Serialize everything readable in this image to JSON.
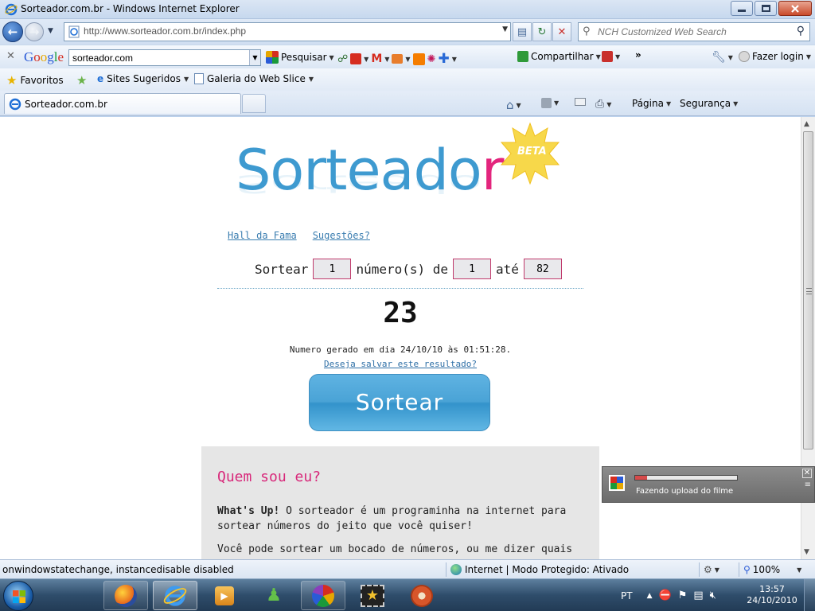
{
  "window": {
    "title": "Sorteador.com.br - Windows Internet Explorer"
  },
  "address": {
    "url": "http://www.sorteador.com.br/index.php"
  },
  "search": {
    "placeholder": "NCH Customized Web Search"
  },
  "google_toolbar": {
    "logo": "Google",
    "query": "sorteador.com",
    "search_label": "Pesquisar",
    "share_label": "Compartilhar",
    "login_label": "Fazer login"
  },
  "favorites": {
    "favorites_label": "Favoritos",
    "suggested_label": "Sites Sugeridos",
    "gallery_label": "Galeria do Web Slice"
  },
  "tabs": {
    "active_title": "Sorteador.com.br"
  },
  "commandbar": {
    "page_label": "Página",
    "security_label": "Segurança"
  },
  "page": {
    "logo_main": "Sorteado",
    "logo_last": "r",
    "beta": "BETA",
    "links": {
      "hall": "Hall da Fama",
      "suggestions": "Sugestões?"
    },
    "form": {
      "prefix": "Sortear",
      "count": "1",
      "middle": "número(s) de",
      "from": "1",
      "until_label": "até",
      "to": "82"
    },
    "result": "23",
    "generated": "Numero gerado em dia 24/10/10 às 01:51:28.",
    "save_link": "Deseja salvar este resultado?",
    "draw_button": "Sortear",
    "about": {
      "heading": "Quem sou eu?",
      "lead": "What's Up!",
      "p1_rest": " O sorteador é um programinha na internet para sortear números do jeito que você quiser!",
      "p2": "Você pode sortear um bocado de números, ou me dizer quais"
    }
  },
  "popup": {
    "text": "Fazendo upload do filme",
    "progress": 0.12
  },
  "statusbar": {
    "message": "onwindowstatechange, instancedisable disabled",
    "zone": "Internet | Modo Protegido: Ativado",
    "zoom": "100%"
  },
  "taskbar": {
    "lang": "PT",
    "time": "13:57",
    "date": "24/10/2010"
  },
  "colors": {
    "logo_blue": "#3e9ad0",
    "logo_pink": "#e3257d",
    "heading_pink": "#d8287a",
    "button_blue": "#4aa3d6"
  }
}
